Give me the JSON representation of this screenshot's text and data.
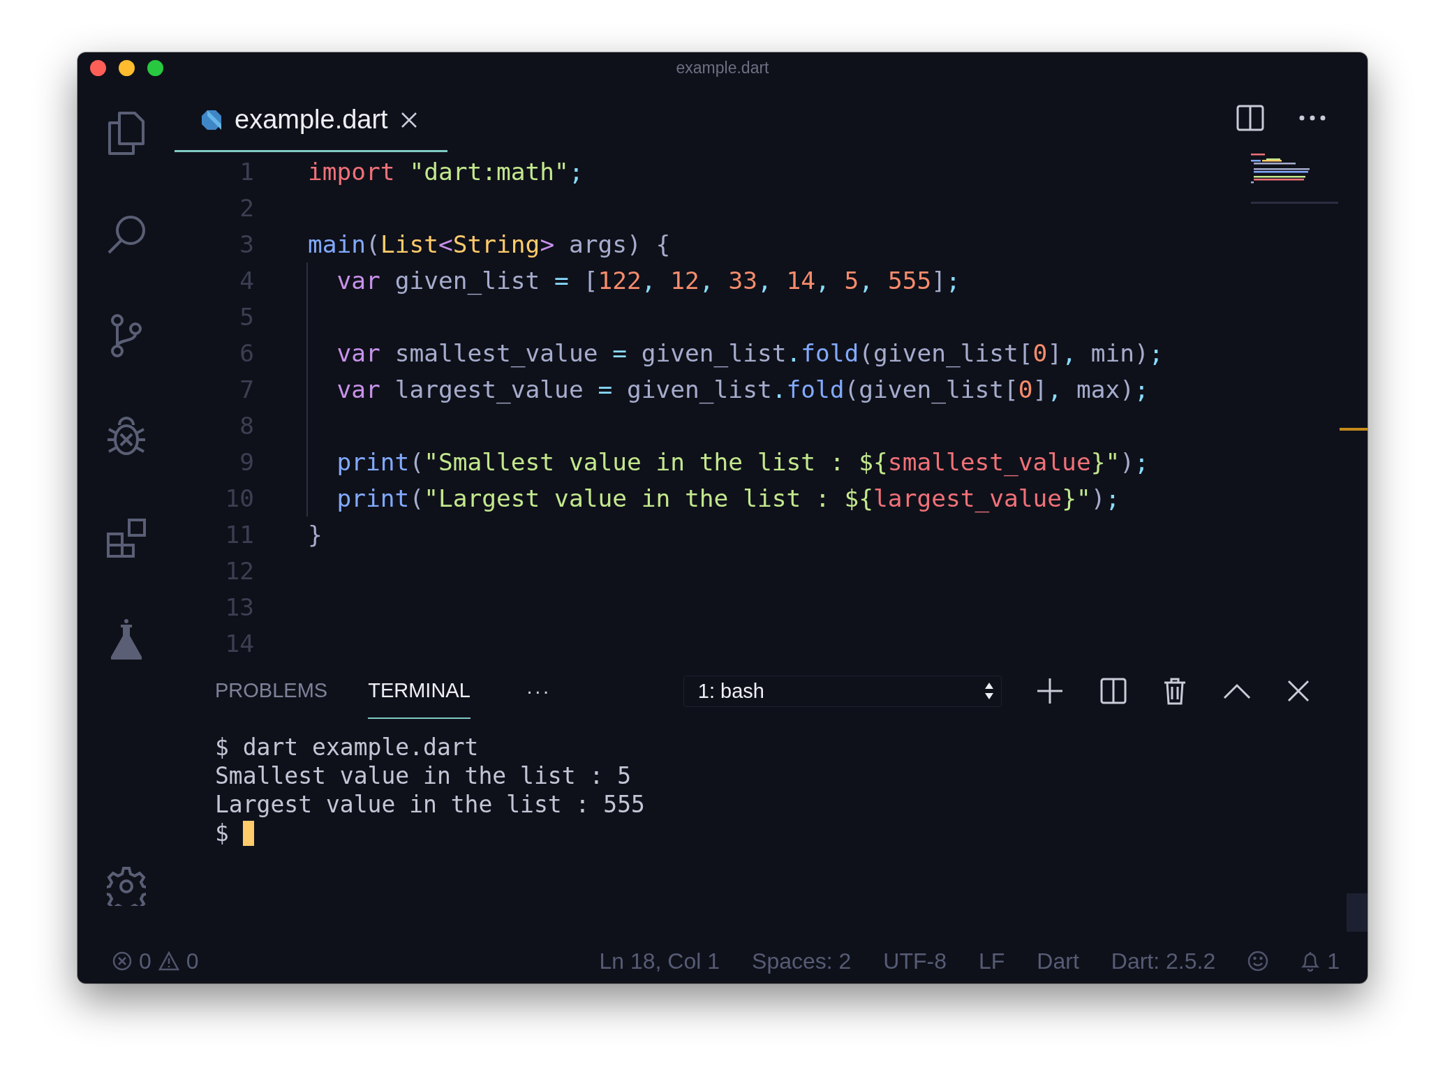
{
  "window": {
    "title": "example.dart"
  },
  "editor_tabs": [
    {
      "label": "example.dart",
      "selected": true
    }
  ],
  "code": {
    "lines": [
      {
        "number": "1",
        "guide": false,
        "tokens": [
          {
            "kind": "kw",
            "text": "import"
          },
          {
            "kind": "str",
            "text": " \"dart:math\""
          },
          {
            "kind": "pu",
            "text": ";"
          }
        ]
      },
      {
        "number": "2",
        "guide": false
      },
      {
        "number": "3",
        "guide": false,
        "tokens": [
          {
            "kind": "fn",
            "text": "main"
          },
          {
            "kind": "pl",
            "text": "("
          },
          {
            "kind": "ty",
            "text": "List"
          },
          {
            "kind": "op",
            "text": "<"
          },
          {
            "kind": "ty",
            "text": "String"
          },
          {
            "kind": "op",
            "text": ">"
          },
          {
            "kind": "pl",
            "text": " args) {"
          }
        ]
      },
      {
        "number": "4",
        "guide": true,
        "tokens": [
          {
            "kind": "st",
            "text": "  var"
          },
          {
            "kind": "pl",
            "text": " given_list "
          },
          {
            "kind": "pu",
            "text": "="
          },
          {
            "kind": "pl",
            "text": " ["
          },
          {
            "kind": "num",
            "text": "122"
          },
          {
            "kind": "pu",
            "text": ","
          },
          {
            "kind": "num",
            "text": " 12"
          },
          {
            "kind": "pu",
            "text": ","
          },
          {
            "kind": "num",
            "text": " 33"
          },
          {
            "kind": "pu",
            "text": ","
          },
          {
            "kind": "num",
            "text": " 14"
          },
          {
            "kind": "pu",
            "text": ","
          },
          {
            "kind": "num",
            "text": " 5"
          },
          {
            "kind": "pu",
            "text": ","
          },
          {
            "kind": "num",
            "text": " 555"
          },
          {
            "kind": "pl",
            "text": "]"
          },
          {
            "kind": "pu",
            "text": ";"
          }
        ]
      },
      {
        "number": "5",
        "guide": true
      },
      {
        "number": "6",
        "guide": true,
        "tokens": [
          {
            "kind": "st",
            "text": "  var"
          },
          {
            "kind": "pl",
            "text": " smallest_value "
          },
          {
            "kind": "pu",
            "text": "="
          },
          {
            "kind": "pl",
            "text": " given_list"
          },
          {
            "kind": "pu",
            "text": "."
          },
          {
            "kind": "fn",
            "text": "fold"
          },
          {
            "kind": "pl",
            "text": "(given_list["
          },
          {
            "kind": "num",
            "text": "0"
          },
          {
            "kind": "pl",
            "text": "]"
          },
          {
            "kind": "pu",
            "text": ","
          },
          {
            "kind": "pl",
            "text": " min)"
          },
          {
            "kind": "pu",
            "text": ";"
          }
        ]
      },
      {
        "number": "7",
        "guide": true,
        "tokens": [
          {
            "kind": "st",
            "text": "  var"
          },
          {
            "kind": "pl",
            "text": " largest_value "
          },
          {
            "kind": "pu",
            "text": "="
          },
          {
            "kind": "pl",
            "text": " given_list"
          },
          {
            "kind": "pu",
            "text": "."
          },
          {
            "kind": "fn",
            "text": "fold"
          },
          {
            "kind": "pl",
            "text": "(given_list["
          },
          {
            "kind": "num",
            "text": "0"
          },
          {
            "kind": "pl",
            "text": "]"
          },
          {
            "kind": "pu",
            "text": ","
          },
          {
            "kind": "pl",
            "text": " max)"
          },
          {
            "kind": "pu",
            "text": ";"
          }
        ]
      },
      {
        "number": "8",
        "guide": true
      },
      {
        "number": "9",
        "guide": true,
        "tokens": [
          {
            "kind": "fn",
            "text": "  print"
          },
          {
            "kind": "pl",
            "text": "("
          },
          {
            "kind": "str",
            "text": "\"Smallest value in the list : ${"
          },
          {
            "kind": "var",
            "text": "smallest_value"
          },
          {
            "kind": "str",
            "text": "}\""
          },
          {
            "kind": "pl",
            "text": ")"
          },
          {
            "kind": "pu",
            "text": ";"
          }
        ]
      },
      {
        "number": "10",
        "guide": true,
        "tokens": [
          {
            "kind": "fn",
            "text": "  print"
          },
          {
            "kind": "pl",
            "text": "("
          },
          {
            "kind": "str",
            "text": "\"Largest value in the list : ${"
          },
          {
            "kind": "var",
            "text": "largest_value"
          },
          {
            "kind": "str",
            "text": "}\""
          },
          {
            "kind": "pl",
            "text": ")"
          },
          {
            "kind": "pu",
            "text": ";"
          }
        ]
      },
      {
        "number": "11",
        "guide": false,
        "tokens": [
          {
            "kind": "pl",
            "text": "}"
          }
        ]
      },
      {
        "number": "12",
        "guide": false
      },
      {
        "number": "13",
        "guide": false
      },
      {
        "number": "14",
        "guide": false
      }
    ]
  },
  "panel": {
    "tabs": [
      {
        "label": "PROBLEMS",
        "selected": false
      },
      {
        "label": "TERMINAL",
        "selected": true
      }
    ],
    "more": "···",
    "terminal_select": {
      "value": "1: bash"
    },
    "terminal": {
      "lines": [
        "$ dart example.dart",
        "Smallest value in the list : 5",
        "Largest value in the list : 555"
      ],
      "prompt": "$"
    }
  },
  "status_bar": {
    "errors": "0",
    "warnings": "0",
    "items": [
      "Ln 18, Col 1",
      "Spaces: 2",
      "UTF-8",
      "LF",
      "Dart",
      "Dart: 2.5.2"
    ],
    "notifications": "1"
  }
}
